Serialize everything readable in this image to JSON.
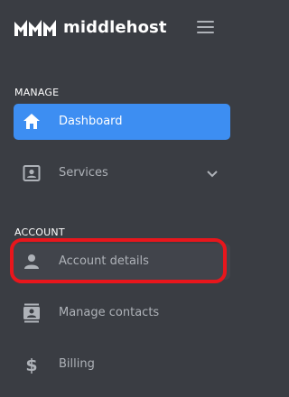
{
  "brand": {
    "name": "middlehost",
    "logo_icon": "middlehost-logo-icon"
  },
  "header": {
    "menu_icon": "hamburger-menu-icon"
  },
  "sections": {
    "manage": "MANAGE",
    "account": "ACCOUNT"
  },
  "nav": {
    "dashboard": {
      "label": "Dashboard",
      "icon": "home-icon",
      "active": true
    },
    "services": {
      "label": "Services",
      "icon": "contact-card-icon",
      "expandable": true
    },
    "account_details": {
      "label": "Account details",
      "icon": "person-icon"
    },
    "manage_contacts": {
      "label": "Manage contacts",
      "icon": "contacts-book-icon"
    },
    "billing": {
      "label": "Billing",
      "icon": "dollar-icon"
    }
  },
  "colors": {
    "sidebar_bg": "#3a3d43",
    "active_bg": "#3d8ef2",
    "text_muted": "#aeb2b8",
    "highlight": "#e8161c"
  }
}
